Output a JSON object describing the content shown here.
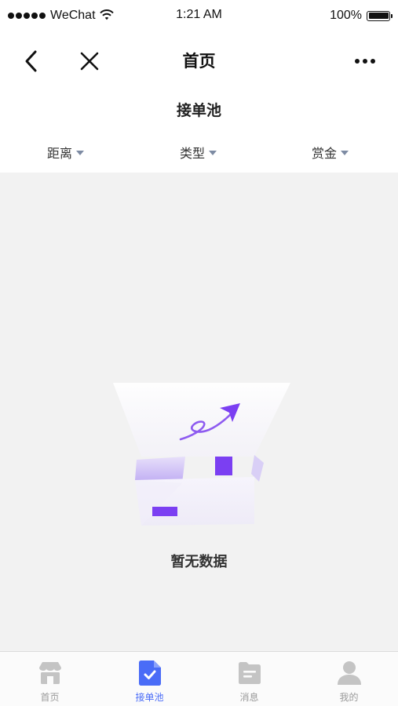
{
  "status_bar": {
    "carrier": "WeChat",
    "time": "1:21 AM",
    "battery": "100%"
  },
  "nav": {
    "title": "首页",
    "back_icon": "chevron-left-icon",
    "close_icon": "close-icon",
    "more_icon": "more-dots-icon"
  },
  "page_heading": "接单池",
  "filters": [
    {
      "label": "距离"
    },
    {
      "label": "类型"
    },
    {
      "label": "赏金"
    }
  ],
  "empty_state": {
    "text": "暂无数据",
    "icon": "empty-box-icon"
  },
  "tabbar": {
    "active_color": "#4a6cf7",
    "inactive_color": "#c4c4c4",
    "items": [
      {
        "label": "首页",
        "icon": "store-icon",
        "active": false
      },
      {
        "label": "接单池",
        "icon": "task-document-icon",
        "active": true
      },
      {
        "label": "消息",
        "icon": "message-folder-icon",
        "active": false
      },
      {
        "label": "我的",
        "icon": "user-icon",
        "active": false
      }
    ]
  },
  "colors": {
    "accent": "#4a6cf7",
    "illustration_purple": "#7b3ff2",
    "filter_arrow": "#7d8ba3",
    "background": "#f2f2f2"
  }
}
